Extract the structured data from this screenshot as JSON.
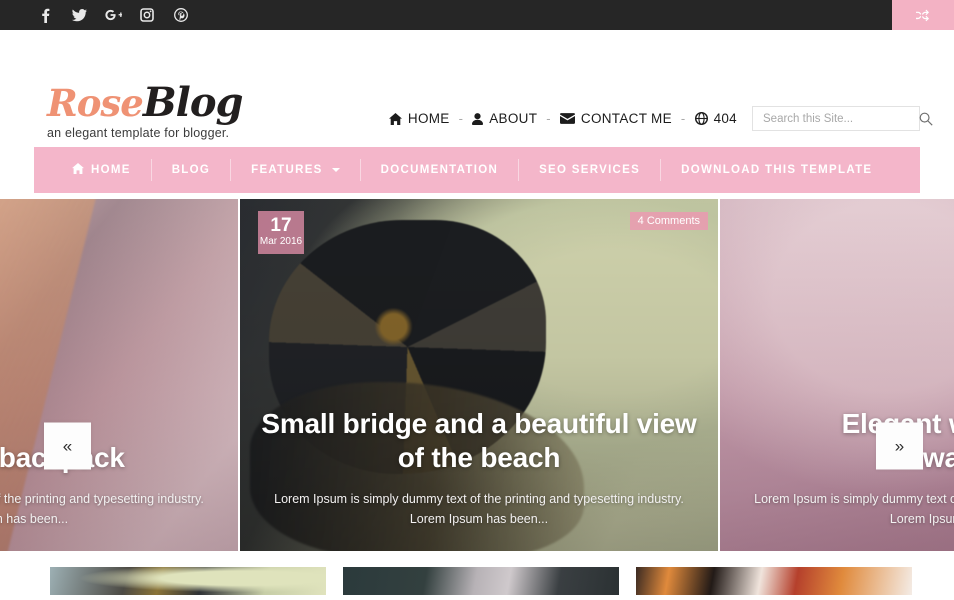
{
  "topbar": {
    "social": [
      {
        "name": "facebook-icon",
        "label": "Facebook"
      },
      {
        "name": "twitter-icon",
        "label": "Twitter"
      },
      {
        "name": "google-plus-icon",
        "label": "Google Plus"
      },
      {
        "name": "instagram-icon",
        "label": "Instagram"
      },
      {
        "name": "pinterest-icon",
        "label": "Pinterest"
      }
    ],
    "random_button_label": "Random Post",
    "accent_color": "#f3b2c4",
    "background_color": "#262626"
  },
  "header": {
    "logo_first": "Rose",
    "logo_second": "Blog",
    "tagline": "an elegant template for blogger.",
    "logo_first_color": "#ef9274",
    "logo_second_color": "#221f1f",
    "nav": [
      {
        "label": "HOME",
        "icon": "home-icon"
      },
      {
        "label": "ABOUT",
        "icon": "user-icon"
      },
      {
        "label": "CONTACT ME",
        "icon": "envelope-icon"
      },
      {
        "label": "404",
        "icon": "globe-icon"
      }
    ],
    "nav_separator": "-",
    "search": {
      "placeholder": "Search this Site...",
      "value": "",
      "button_icon": "search-icon"
    }
  },
  "menubar": {
    "background_color": "#f4b6ca",
    "items": [
      {
        "label": "HOME",
        "icon": "home-icon",
        "caret": false
      },
      {
        "label": "BLOG",
        "icon": "",
        "caret": false
      },
      {
        "label": "FEATURES",
        "icon": "",
        "caret": true
      },
      {
        "label": "DOCUMENTATION",
        "icon": "",
        "caret": false
      },
      {
        "label": "SEO SERVICES",
        "icon": "",
        "caret": false
      },
      {
        "label": "DOWNLOAD THIS TEMPLATE",
        "icon": "",
        "caret": false
      }
    ]
  },
  "slider": {
    "prev_label": "«",
    "next_label": "»",
    "slides": [
      {
        "title": "Beautiful backpack",
        "excerpt": "Lorem Ipsum is simply dummy text of the printing and typesetting industry. Lorem Ipsum has been...",
        "date_day": "",
        "date_month": "",
        "comments": ""
      },
      {
        "title": "Small bridge and a beautiful view\nof the beach",
        "excerpt": "Lorem Ipsum is simply dummy text of the printing and typesetting industry. Lorem Ipsum has been...",
        "date_day": "17",
        "date_month": "Mar 2016",
        "comments": "4 Comments"
      },
      {
        "title": "Elegant woman in\nwater",
        "excerpt": "Lorem Ipsum is simply dummy text of the printing and typesetting industry. Lorem Ipsum has been...",
        "date_day": "",
        "date_month": "",
        "comments": ""
      }
    ]
  },
  "posts_row": {
    "thumbnails": [
      {
        "name": "post-thumbnail-1"
      },
      {
        "name": "post-thumbnail-2"
      },
      {
        "name": "post-thumbnail-3"
      }
    ]
  }
}
